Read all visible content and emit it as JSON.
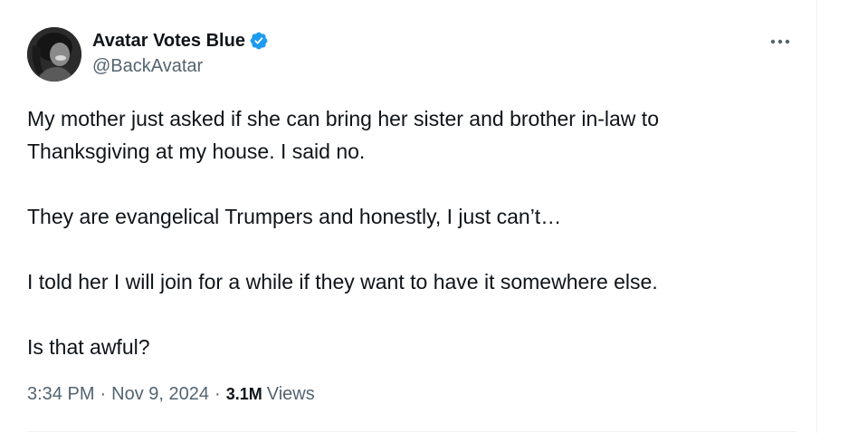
{
  "author": {
    "display_name": "Avatar Votes Blue",
    "handle": "@BackAvatar",
    "verified_icon": "verified-badge-icon",
    "verified_color": "#1d9bf0"
  },
  "more_icon": "more-horizontal-icon",
  "tweet": {
    "line1": "My mother just asked if she can bring her sister and brother in-law to",
    "line2": "Thanksgiving at my house.  I said no.",
    "line3": "They are evangelical Trumpers and honestly, I just can’t…",
    "line4": "I told her I will join for a while if they want to have it somewhere else.",
    "line5": "Is that awful?"
  },
  "meta": {
    "time": "3:34 PM",
    "separator": "·",
    "date": "Nov 9, 2024",
    "views_count": "3.1M",
    "views_label": "Views"
  },
  "colors": {
    "text_primary": "#0f1419",
    "text_secondary": "#536471",
    "border": "#eff3f4"
  }
}
